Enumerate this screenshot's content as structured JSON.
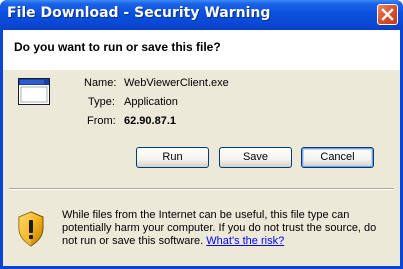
{
  "window": {
    "title": "File Download - Security Warning"
  },
  "dialog": {
    "question": "Do you want to run or save this file?",
    "name_label": "Name:",
    "name_value": "WebViewerClient.exe",
    "type_label": "Type:",
    "type_value": "Application",
    "from_label": "From:",
    "from_value": "62.90.87.1"
  },
  "buttons": {
    "run": "Run",
    "save": "Save",
    "cancel": "Cancel"
  },
  "warning": {
    "text": "While files from the Internet can be useful, this file type can potentially harm your computer. If you do not trust the source, do not run or save this software.",
    "link": "What's the risk?"
  },
  "icons": {
    "title_close": "close-icon",
    "file": "application-window-icon",
    "warning": "security-shield-warning-icon"
  },
  "colors": {
    "titlebar": "#0a49d6",
    "dialog_bg": "#ece9d8",
    "link": "#0000ff",
    "close_button": "#d9502c"
  }
}
